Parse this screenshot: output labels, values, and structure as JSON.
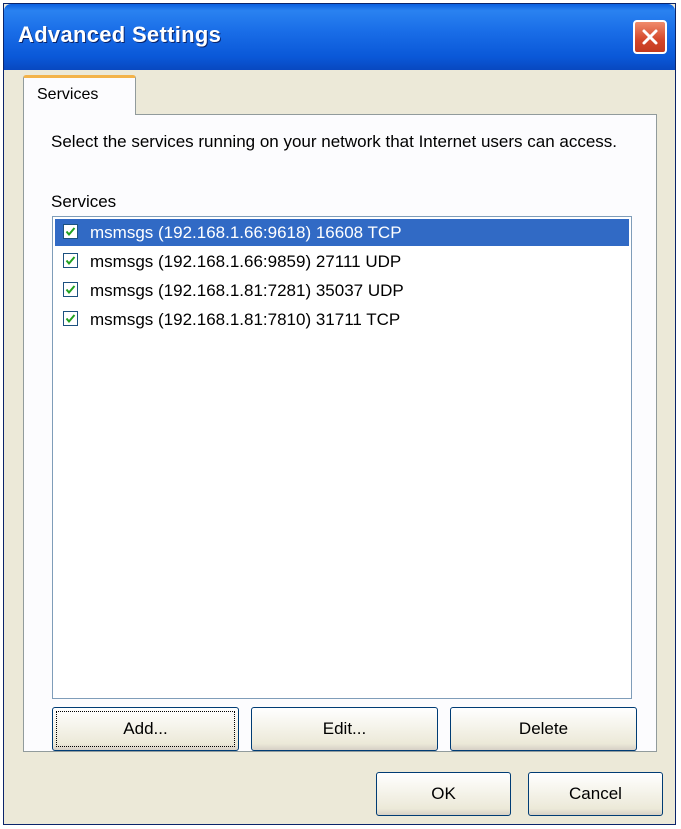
{
  "window": {
    "title": "Advanced Settings"
  },
  "tabs": [
    {
      "label": "Services",
      "active": true
    }
  ],
  "panel": {
    "description": "Select the services running on your network that Internet users can access.",
    "list_label": "Services",
    "services": [
      {
        "text": "msmsgs (192.168.1.66:9618) 16608 TCP",
        "checked": true,
        "selected": true
      },
      {
        "text": "msmsgs (192.168.1.66:9859) 27111 UDP",
        "checked": true,
        "selected": false
      },
      {
        "text": "msmsgs (192.168.1.81:7281) 35037 UDP",
        "checked": true,
        "selected": false
      },
      {
        "text": "msmsgs (192.168.1.81:7810) 31711 TCP",
        "checked": true,
        "selected": false
      }
    ],
    "buttons": {
      "add": "Add...",
      "edit": "Edit...",
      "delete": "Delete"
    }
  },
  "footer": {
    "ok": "OK",
    "cancel": "Cancel"
  },
  "colors": {
    "title_bar": "#0a5fe0",
    "selection": "#316ac5",
    "tab_highlight": "#f3b34a",
    "close_button": "#d4472a"
  }
}
